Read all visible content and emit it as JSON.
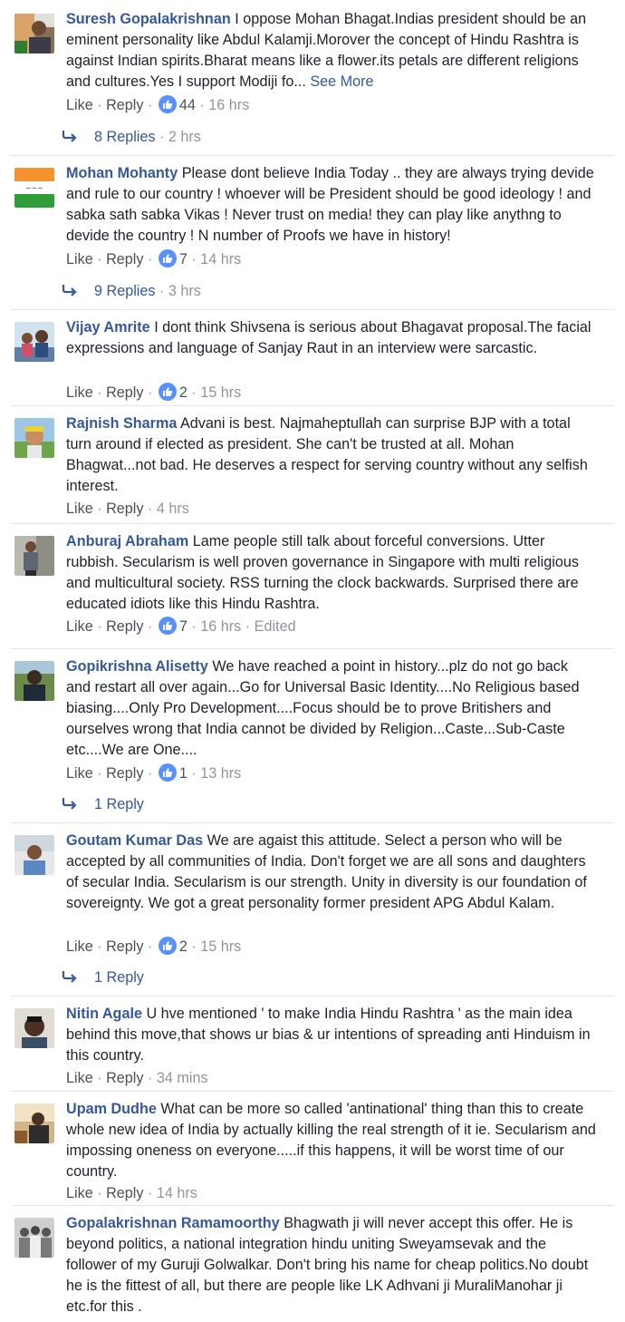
{
  "labels": {
    "like": "Like",
    "reply": "Reply",
    "sep": "·",
    "see_more": "See More"
  },
  "comments": [
    {
      "name": "Suresh Gopalakrishnan",
      "text": "I oppose Mohan Bhagat.Indias president should be an eminent personality like Abdul Kalamji.Morover the concept of Hindu Rashtra is against Indian spirits.Bharat means like a flower.its petals are different religions and cultures.Yes I support Modiji fo...",
      "likes": "44",
      "time": "16 hrs",
      "replies": "8 Replies",
      "replies_time": "2 hrs",
      "avatar": "flag-portrait"
    },
    {
      "name": "Mohan Mohanty",
      "text": "Please dont believe India Today .. they are always trying devide and rule to our country ! whoever will be President should be good ideology ! and sabka sath sabka Vikas ! Never trust on media! they can play like anythng to devide the country ! N number of Proofs we have in history!",
      "likes": "7",
      "time": "14 hrs",
      "replies": "9 Replies",
      "replies_time": "3 hrs",
      "avatar": "tricolor-text"
    },
    {
      "name": "Vijay Amrite",
      "text": "I dont think Shivsena is serious about Bhagavat proposal.The facial expressions and language of Sanjay Raut in an interview were sarcastic.",
      "likes": "2",
      "time": "15 hrs",
      "avatar": "family-photo"
    },
    {
      "name": "Rajnish Sharma",
      "text": "Advani is best. Najmaheptullah can surprise BJP with a total turn around if elected as president. She can't be trusted at all. Mohan Bhagwat...not bad. He deserves a respect for serving country without any selfish interest.",
      "time": "4 hrs",
      "avatar": "cap-portrait"
    },
    {
      "name": "Anburaj Abraham",
      "text": "Lame people still talk about forceful conversions. Utter rubbish. Secularism is well proven governance in Singapore with multi religious and multicultural society. RSS turning the clock backwards. Surprised there are educated idiots like this Hindu Rashtra.",
      "likes": "7",
      "time": "16 hrs",
      "edited": "Edited",
      "avatar": "standing-man"
    },
    {
      "name": "Gopikrishna Alisetty",
      "text": "We have reached a point in history...plz do not go back and restart all over again...Go for Universal Basic Identity....No Religious based biasing....Only Pro Development....Focus should be to prove Britishers and ourselves wrong that India cannot be divided by Religion...Caste...Sub-Caste etc....We are One....",
      "likes": "1",
      "time": "13 hrs",
      "replies": "1 Reply",
      "avatar": "outdoor-portrait"
    },
    {
      "name": "Goutam Kumar Das",
      "text": "We are agaist this attitude. Select a person who will be accepted by all communities of India. Don't forget we are all sons and daughters of secular India. Secularism is our strength. Unity in diversity is our foundation of sovereignty. We got a great personality former president APG Abdul Kalam.",
      "likes": "2",
      "time": "15 hrs",
      "replies": "1 Reply",
      "avatar": "office-portrait"
    },
    {
      "name": "Nitin Agale",
      "text": "U hve mentioned ' to make India Hindu Rashtra ' as the main idea behind this move,that shows ur bias & ur intentions of spreading anti Hinduism in this country.",
      "time": "34 mins",
      "avatar": "face-portrait"
    },
    {
      "name": "Upam Dudhe",
      "text": "What can be more so called 'antinational' thing than this to create whole new idea of India by actually killing the real strength of it ie. Secularism and impossing oneness on everyone.....if this happens, it will be worst time of our country.",
      "time": "14 hrs",
      "avatar": "seated-portrait"
    },
    {
      "name": "Gopalakrishnan Ramamoorthy",
      "text": "Bhagwath ji will never accept this offer. He is beyond politics, a national integration hindu uniting Sweyamsevak and the follower of my Guruji Golwalkar. Don't bring his name for cheap politics.No doubt he is the fittest of all, but there are people like LK Adhvani ji MuraliManohar ji etc.for this .",
      "avatar": "group-bw"
    }
  ],
  "colors": {
    "name": "#365899",
    "text": "#1d2129",
    "meta": "#90949c",
    "like_badge": "#5890ff"
  }
}
